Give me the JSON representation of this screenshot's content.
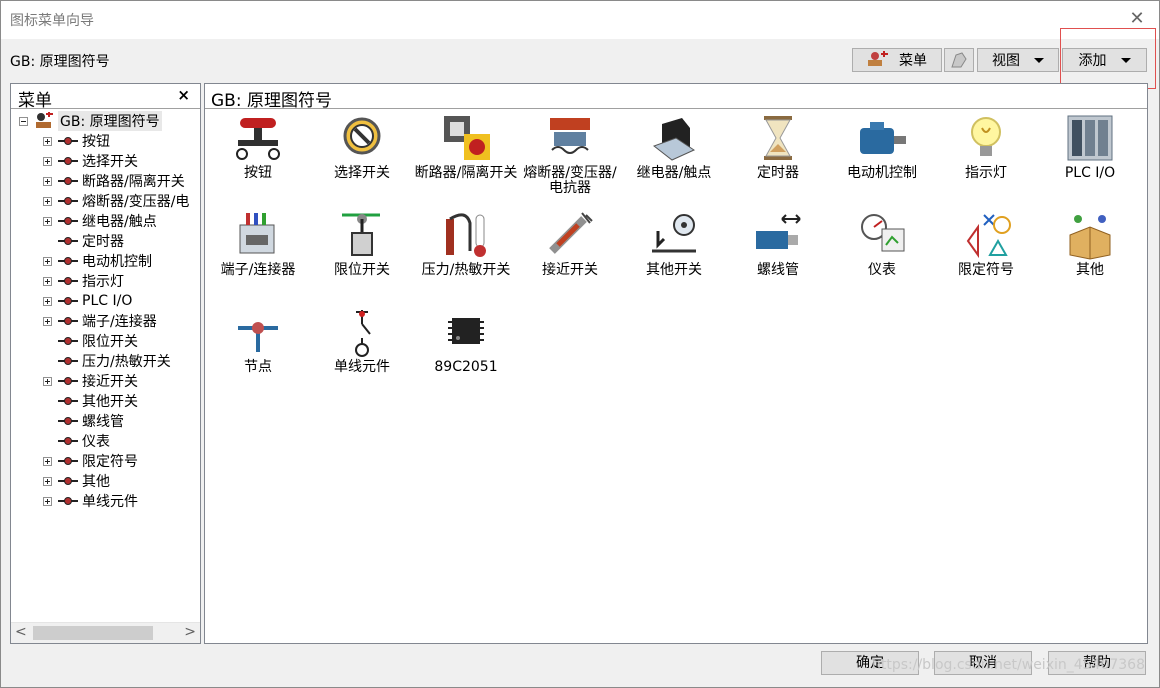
{
  "window": {
    "title": "图标菜单向导",
    "close_glyph": "✕"
  },
  "toolbar": {
    "path_label": "GB: 原理图符号",
    "menu_label": "菜单",
    "view_label": "视图",
    "add_label": "添加"
  },
  "left_pane": {
    "title": "菜单",
    "close_glyph": "×",
    "root_label": "GB: 原理图符号",
    "items": [
      {
        "label": "按钮",
        "expandable": true
      },
      {
        "label": "选择开关",
        "expandable": true
      },
      {
        "label": "断路器/隔离开关",
        "expandable": true
      },
      {
        "label": "熔断器/变压器/电",
        "expandable": true
      },
      {
        "label": "继电器/触点",
        "expandable": true
      },
      {
        "label": "定时器",
        "expandable": false
      },
      {
        "label": "电动机控制",
        "expandable": true
      },
      {
        "label": "指示灯",
        "expandable": true
      },
      {
        "label": "PLC I/O",
        "expandable": true
      },
      {
        "label": "端子/连接器",
        "expandable": true
      },
      {
        "label": "限位开关",
        "expandable": false
      },
      {
        "label": "压力/热敏开关",
        "expandable": false
      },
      {
        "label": "接近开关",
        "expandable": true
      },
      {
        "label": "其他开关",
        "expandable": false
      },
      {
        "label": "螺线管",
        "expandable": false
      },
      {
        "label": "仪表",
        "expandable": false
      },
      {
        "label": "限定符号",
        "expandable": true
      },
      {
        "label": "其他",
        "expandable": true
      },
      {
        "label": "单线元件",
        "expandable": true
      }
    ],
    "scroll_left": "<",
    "scroll_right": ">"
  },
  "right_pane": {
    "title": "GB: 原理图符号",
    "icons": [
      {
        "label": "按钮",
        "icon": "pushbutton-icon"
      },
      {
        "label": "选择开关",
        "icon": "selector-switch-icon"
      },
      {
        "label": "断路器/隔离开关",
        "icon": "circuit-breaker-icon"
      },
      {
        "label": "熔断器/变压器/电抗器",
        "icon": "fuse-transformer-icon"
      },
      {
        "label": "继电器/触点",
        "icon": "relay-icon"
      },
      {
        "label": "定时器",
        "icon": "hourglass-icon"
      },
      {
        "label": "电动机控制",
        "icon": "motor-icon"
      },
      {
        "label": "指示灯",
        "icon": "lamp-icon"
      },
      {
        "label": "PLC I/O",
        "icon": "plc-icon"
      },
      {
        "label": "端子/连接器",
        "icon": "terminal-icon"
      },
      {
        "label": "限位开关",
        "icon": "limit-switch-icon"
      },
      {
        "label": "压力/热敏开关",
        "icon": "pressure-thermo-icon"
      },
      {
        "label": "接近开关",
        "icon": "proximity-switch-icon"
      },
      {
        "label": "其他开关",
        "icon": "other-switch-icon"
      },
      {
        "label": "螺线管",
        "icon": "solenoid-icon"
      },
      {
        "label": "仪表",
        "icon": "meter-icon"
      },
      {
        "label": "限定符号",
        "icon": "qualifier-icon"
      },
      {
        "label": "其他",
        "icon": "misc-box-icon"
      },
      {
        "label": "节点",
        "icon": "node-icon"
      },
      {
        "label": "单线元件",
        "icon": "single-line-icon"
      },
      {
        "label": "89C2051",
        "icon": "chip-icon"
      }
    ]
  },
  "buttons": {
    "ok": "确定",
    "cancel": "取消",
    "help": "帮助"
  },
  "watermark": "https://blog.csdn.net/weixin_45407368",
  "colors": {
    "highlight_box": "#e0504f",
    "button_face": "#e1e1e1"
  }
}
